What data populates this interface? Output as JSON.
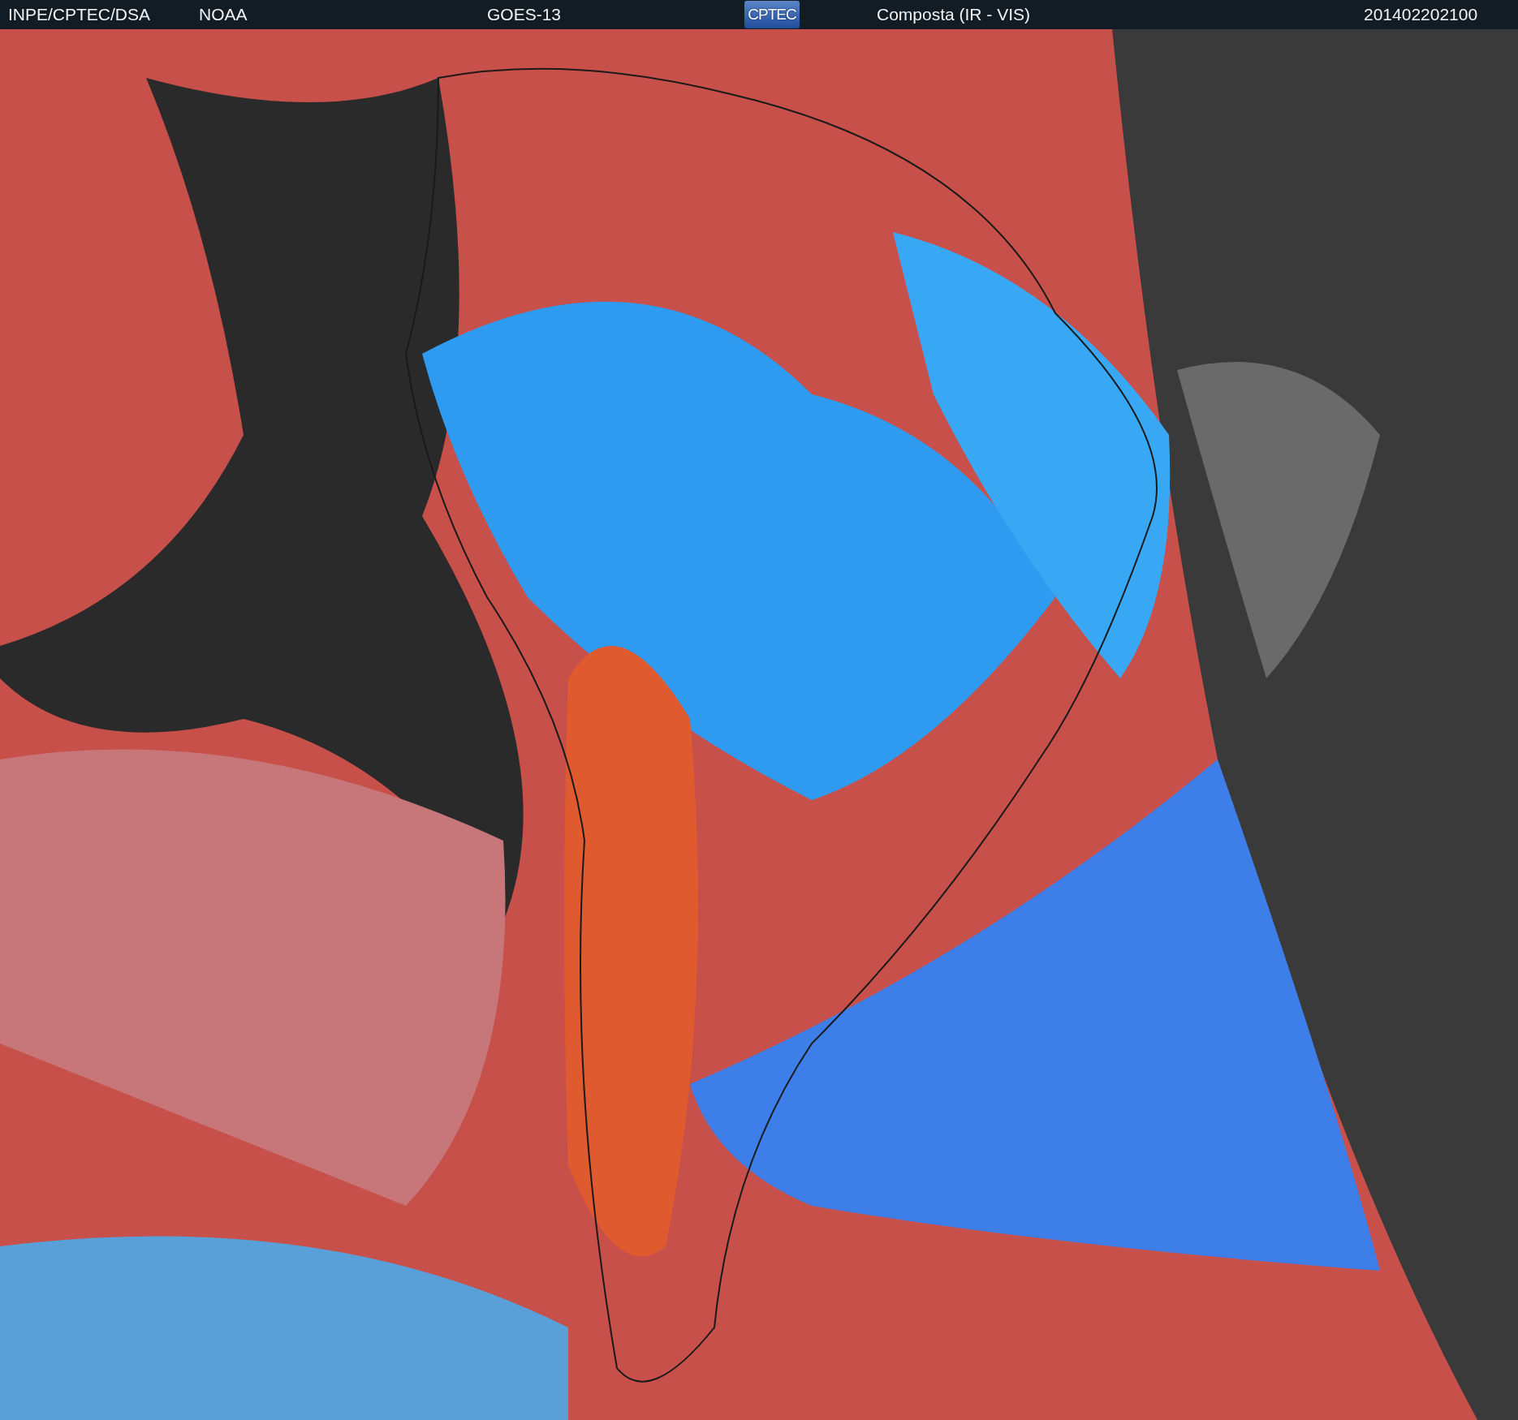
{
  "header": {
    "source": "INPE/CPTEC/DSA",
    "agency": "NOAA",
    "satellite": "GOES-13",
    "logo": "CPTEC",
    "product": "Composta (IR - VIS)",
    "timestamp": "201402202100"
  }
}
